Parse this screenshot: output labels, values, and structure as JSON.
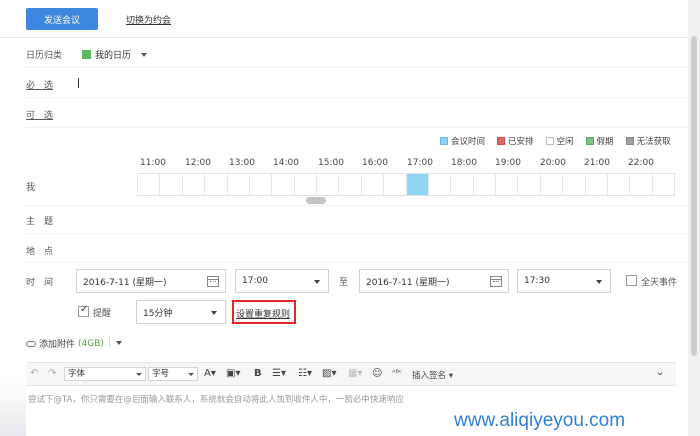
{
  "topbar": {
    "send_label": "发送会议",
    "switch_label": "切换为约会"
  },
  "calendar": {
    "label": "日历归类",
    "value": "我的日历",
    "swatch_color": "#5cb85c"
  },
  "required": {
    "label": "必　选"
  },
  "optional": {
    "label": "可　选"
  },
  "legend": [
    {
      "label": "会议时间",
      "color": "#8fd4f5"
    },
    {
      "label": "已安排",
      "color": "#e06666"
    },
    {
      "label": "空闲",
      "color": "#ffffff"
    },
    {
      "label": "假期",
      "color": "#7cc07c"
    },
    {
      "label": "无法获取",
      "color": "#a0a0a0"
    }
  ],
  "timeline": {
    "hours": [
      "11:00",
      "12:00",
      "13:00",
      "14:00",
      "15:00",
      "16:00",
      "17:00",
      "18:00",
      "19:00",
      "20:00",
      "21:00",
      "22:00"
    ],
    "attendee_label": "我",
    "meeting_slot": "17:00-17:30"
  },
  "subject": {
    "label": "主　题"
  },
  "location": {
    "label": "地　点"
  },
  "time": {
    "label": "时　间",
    "start_date": "2016-7-11 (星期一)",
    "start_time": "17:00",
    "to_label": "至",
    "end_date": "2016-7-11 (星期一)",
    "end_time": "17:30",
    "all_day_label": "全天事件"
  },
  "reminder": {
    "label": "提醒",
    "checked": true,
    "value": "15分钟",
    "repeat_label": "设置重复规则"
  },
  "attachment": {
    "label": "添加附件",
    "size": "(4GB)"
  },
  "toolbar": {
    "font_label": "字体",
    "size_label": "字号",
    "bold": "B",
    "signature_label": "插入签名"
  },
  "editor": {
    "placeholder": "尝试下@TA，你只需要在@后面输入联系人，系统就会自动将此人加到收件人中，一箭必中快速响应"
  },
  "watermark": "www.aliqiyeyou.com"
}
